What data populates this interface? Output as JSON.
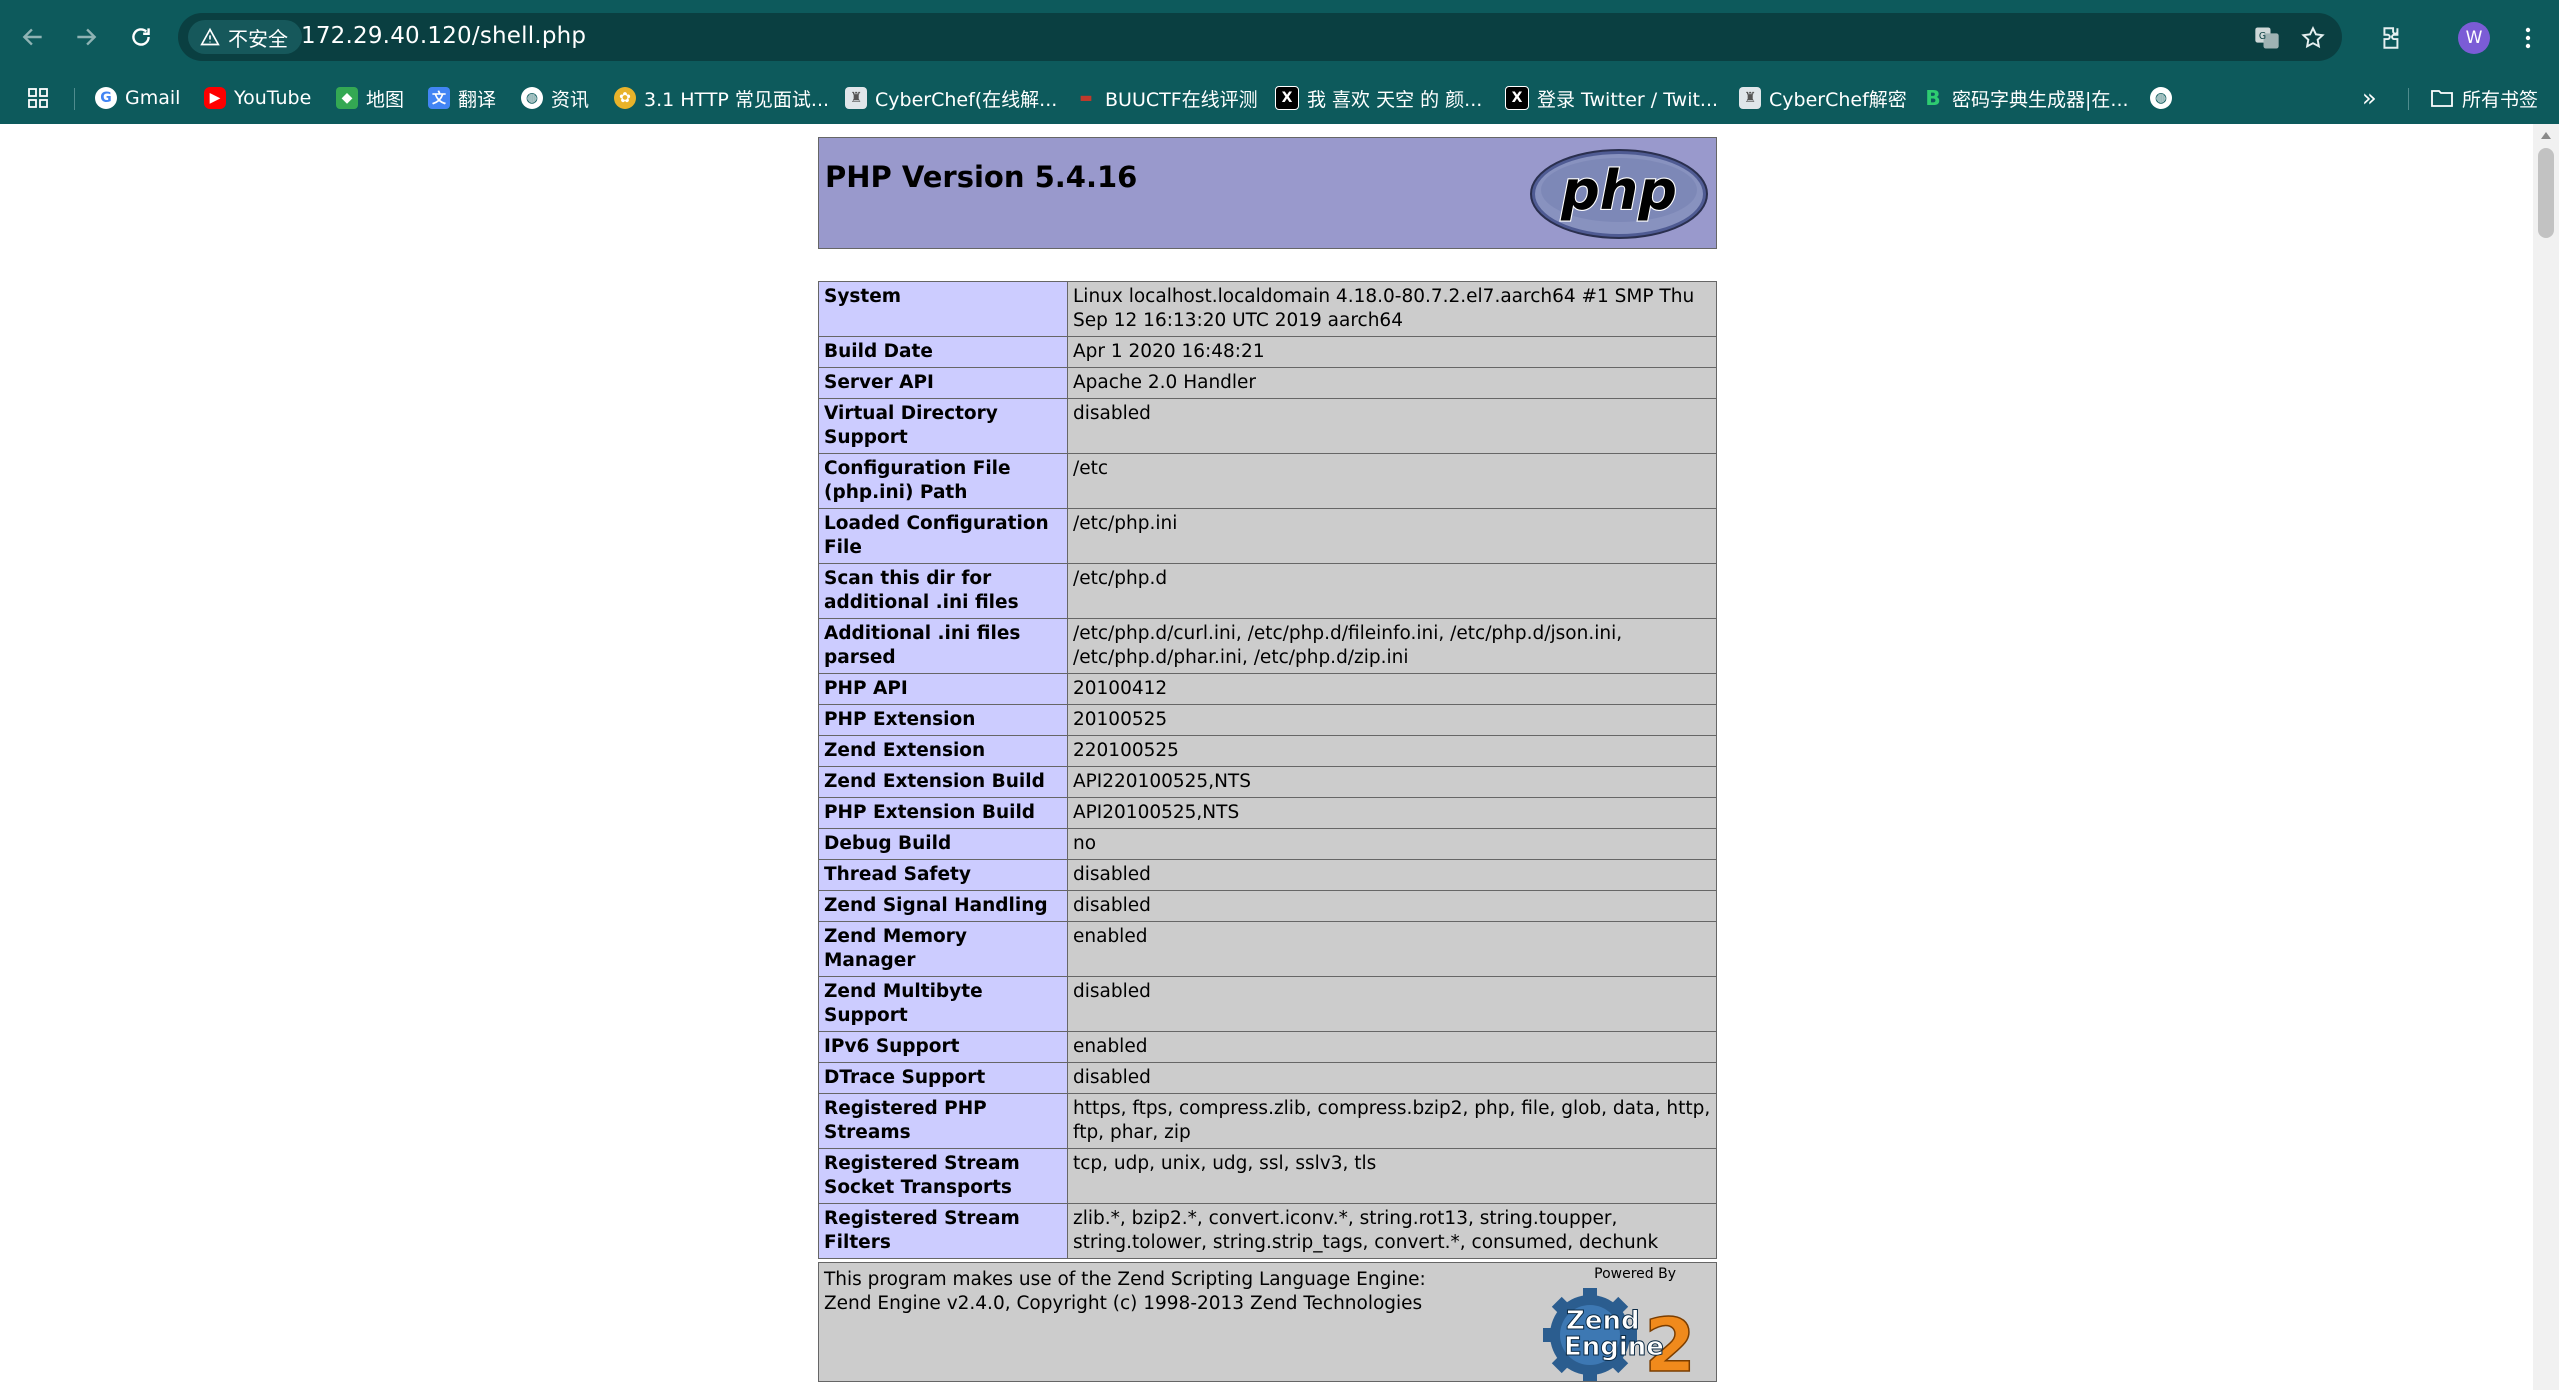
{
  "browser": {
    "security_label": "不安全",
    "url": "172.29.40.120/shell.php",
    "profile_initial": "W"
  },
  "bookmarks": [
    {
      "label": "Gmail",
      "icon": "google-icon"
    },
    {
      "label": "YouTube",
      "icon": "youtube-icon"
    },
    {
      "label": "地图",
      "icon": "maps-icon"
    },
    {
      "label": "翻译",
      "icon": "translate-icon"
    },
    {
      "label": "资讯",
      "icon": "globe-icon"
    },
    {
      "label": "3.1 HTTP 常见面试...",
      "icon": "site-icon"
    },
    {
      "label": "CyberChef(在线解...",
      "icon": "cyberchef-icon"
    },
    {
      "label": "BUUCTF在线评测",
      "icon": "buuctf-icon"
    },
    {
      "label": "我 喜欢 天空 的 颜...",
      "icon": "x-icon"
    },
    {
      "label": "登录 Twitter / Twit...",
      "icon": "x-icon"
    },
    {
      "label": "CyberChef解密",
      "icon": "cyberchef-icon"
    },
    {
      "label": "密码字典生成器|在...",
      "icon": "b-icon"
    }
  ],
  "bookmarks_overflow": "»",
  "all_bookmarks_label": "所有书签",
  "phpinfo": {
    "title": "PHP Version 5.4.16",
    "logo_text": "php",
    "rows": [
      {
        "key": "System",
        "value": "Linux localhost.localdomain 4.18.0-80.7.2.el7.aarch64 #1 SMP Thu Sep 12 16:13:20 UTC 2019 aarch64"
      },
      {
        "key": "Build Date",
        "value": "Apr 1 2020 16:48:21"
      },
      {
        "key": "Server API",
        "value": "Apache 2.0 Handler"
      },
      {
        "key": "Virtual Directory Support",
        "value": "disabled"
      },
      {
        "key": "Configuration File (php.ini) Path",
        "value": "/etc"
      },
      {
        "key": "Loaded Configuration File",
        "value": "/etc/php.ini"
      },
      {
        "key": "Scan this dir for additional .ini files",
        "value": "/etc/php.d"
      },
      {
        "key": "Additional .ini files parsed",
        "value": "/etc/php.d/curl.ini, /etc/php.d/fileinfo.ini, /etc/php.d/json.ini, /etc/php.d/phar.ini, /etc/php.d/zip.ini"
      },
      {
        "key": "PHP API",
        "value": "20100412"
      },
      {
        "key": "PHP Extension",
        "value": "20100525"
      },
      {
        "key": "Zend Extension",
        "value": "220100525"
      },
      {
        "key": "Zend Extension Build",
        "value": "API220100525,NTS"
      },
      {
        "key": "PHP Extension Build",
        "value": "API20100525,NTS"
      },
      {
        "key": "Debug Build",
        "value": "no"
      },
      {
        "key": "Thread Safety",
        "value": "disabled"
      },
      {
        "key": "Zend Signal Handling",
        "value": "disabled"
      },
      {
        "key": "Zend Memory Manager",
        "value": "enabled"
      },
      {
        "key": "Zend Multibyte Support",
        "value": "disabled"
      },
      {
        "key": "IPv6 Support",
        "value": "enabled"
      },
      {
        "key": "DTrace Support",
        "value": "disabled"
      },
      {
        "key": "Registered PHP Streams",
        "value": "https, ftps, compress.zlib, compress.bzip2, php, file, glob, data, http, ftp, phar, zip"
      },
      {
        "key": "Registered Stream Socket Transports",
        "value": "tcp, udp, unix, udg, ssl, sslv3, tls"
      },
      {
        "key": "Registered Stream Filters",
        "value": "zlib.*, bzip2.*, convert.iconv.*, string.rot13, string.toupper, string.tolower, string.strip_tags, convert.*, consumed, dechunk"
      }
    ],
    "zend": {
      "line1": "This program makes use of the Zend Scripting Language Engine:",
      "line2": "Zend Engine v2.4.0, Copyright (c) 1998-2013 Zend Technologies",
      "powered_by": "Powered By",
      "logo_line1": "Zend",
      "logo_line2": "Engine",
      "logo_version": "2"
    }
  },
  "colors": {
    "chrome_bg": "#0d5a5c",
    "header_bg": "#9999cc",
    "key_bg": "#ccccff",
    "value_bg": "#cccccc"
  }
}
